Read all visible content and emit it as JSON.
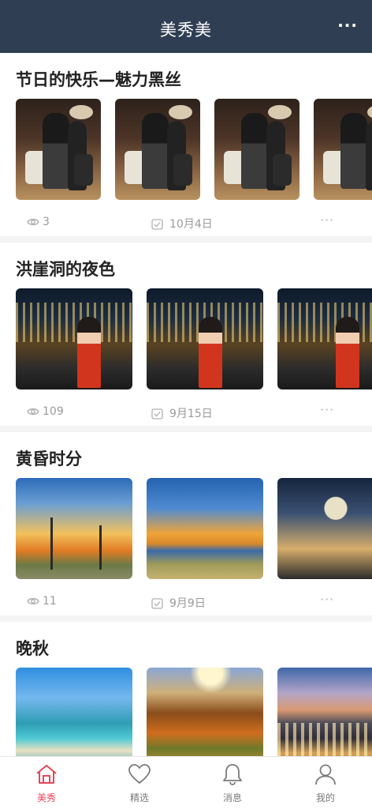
{
  "header": {
    "title": "美秀美",
    "more_label": "···"
  },
  "sections": [
    {
      "title": "节日的快乐—魅力黑丝",
      "views": "3",
      "date": "10月4日",
      "more": "···"
    },
    {
      "title": "洪崖洞的夜色",
      "views": "109",
      "date": "9月15日",
      "more": "···"
    },
    {
      "title": "黄昏时分",
      "views": "11",
      "date": "9月9日",
      "more": "···"
    },
    {
      "title": "晚秋"
    }
  ],
  "tabbar": {
    "items": [
      {
        "label": "美秀",
        "icon": "home-icon",
        "active": true
      },
      {
        "label": "精选",
        "icon": "heart-icon",
        "active": false
      },
      {
        "label": "消息",
        "icon": "bell-icon",
        "active": false
      },
      {
        "label": "我的",
        "icon": "person-icon",
        "active": false
      }
    ]
  },
  "colors": {
    "header_bg": "#2f3e52",
    "accent": "#e8465a",
    "meta_text": "#9a9a9a"
  }
}
